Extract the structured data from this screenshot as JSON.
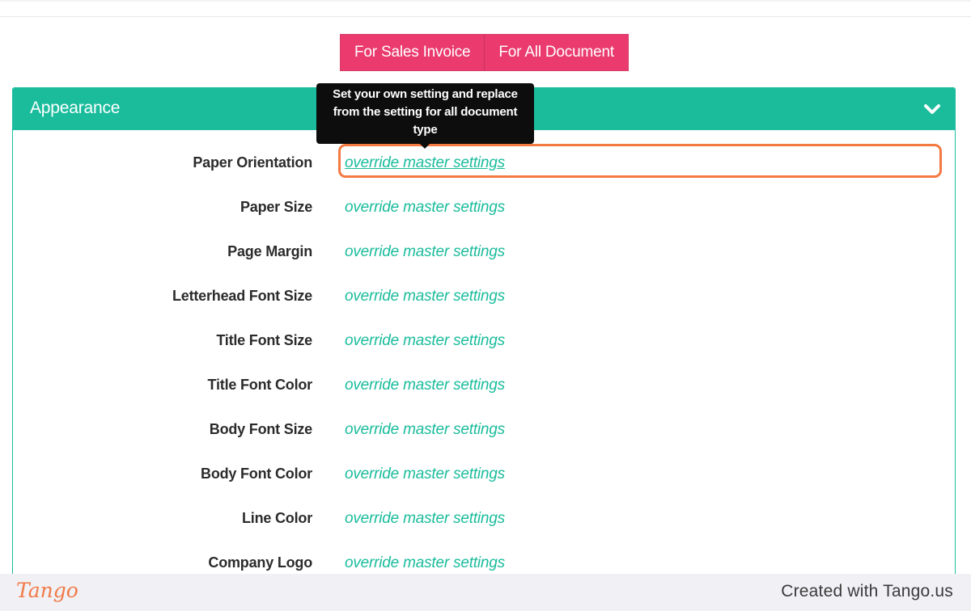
{
  "toggle": {
    "sales_invoice_label": "For Sales Invoice",
    "all_document_label": "For All Document"
  },
  "panel": {
    "title": "Appearance",
    "collapse_icon": "chevron-down-icon"
  },
  "tooltip": {
    "text": "Set your own setting and replace from the setting for all document type"
  },
  "settings": [
    {
      "label": "Paper Orientation",
      "link": "override master settings"
    },
    {
      "label": "Paper Size",
      "link": "override master settings"
    },
    {
      "label": "Page Margin",
      "link": "override master settings"
    },
    {
      "label": "Letterhead Font Size",
      "link": "override master settings"
    },
    {
      "label": "Title Font Size",
      "link": "override master settings"
    },
    {
      "label": "Title Font Color",
      "link": "override master settings"
    },
    {
      "label": "Body Font Size",
      "link": "override master settings"
    },
    {
      "label": "Body Font Color",
      "link": "override master settings"
    },
    {
      "label": "Line Color",
      "link": "override master settings"
    },
    {
      "label": "Company Logo",
      "link": "override master settings"
    }
  ],
  "footer": {
    "logo_text": "Tango",
    "credit": "Created with Tango.us"
  },
  "colors": {
    "accent": "#1abc9c",
    "toggle_active": "#ea3a6e",
    "highlight": "#f47a42",
    "tooltip_bg": "#0d0d0d"
  }
}
